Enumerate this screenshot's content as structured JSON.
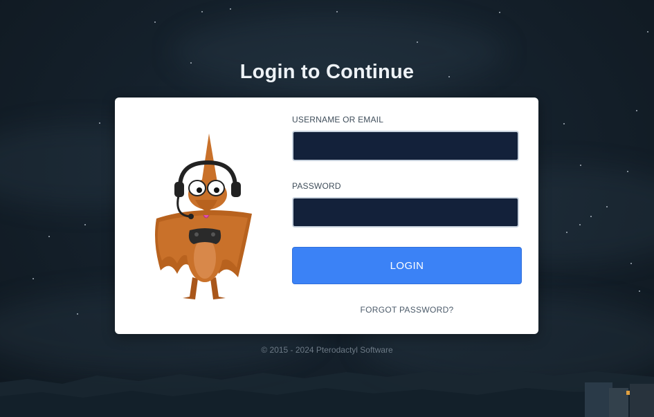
{
  "page": {
    "title": "Login to Continue"
  },
  "login_form": {
    "username_label": "USERNAME OR EMAIL",
    "username_value": "",
    "password_label": "PASSWORD",
    "password_value": "",
    "login_button_label": "LOGIN",
    "forgot_password_label": "FORGOT PASSWORD?"
  },
  "mascot": {
    "icon": "pterodactyl-gamer-mascot"
  },
  "footer": {
    "copyright": "© 2015 - 2024 Pterodactyl Software"
  },
  "colors": {
    "background": "#15212c",
    "card": "#ffffff",
    "input_bg": "#13213a",
    "accent": "#3b82f6"
  }
}
